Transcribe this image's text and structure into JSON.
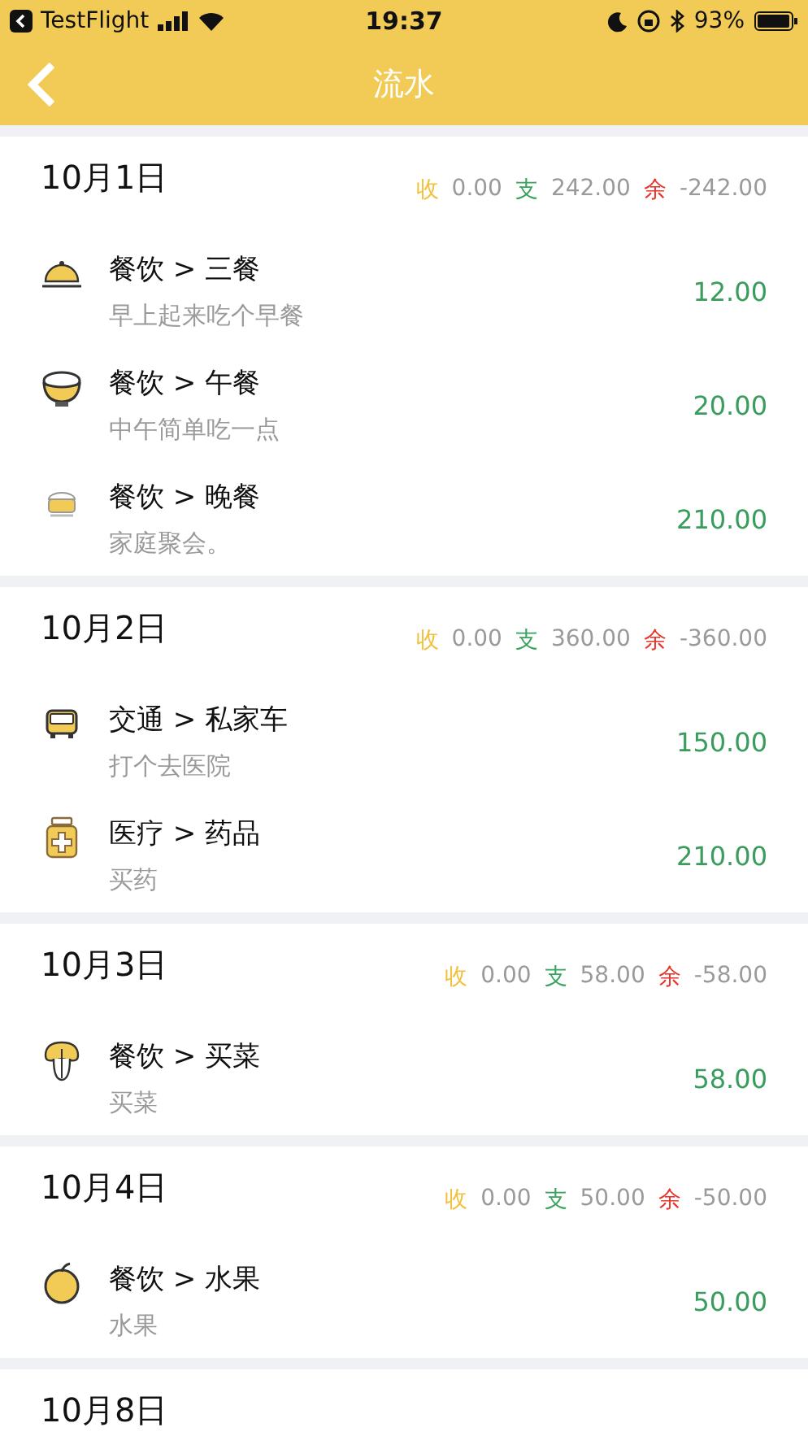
{
  "status_bar": {
    "back_app": "TestFlight",
    "time": "19:37",
    "battery": "93%"
  },
  "nav": {
    "title": "流水"
  },
  "days": [
    {
      "date": "10月1日",
      "stats": [
        {
          "kind": "income",
          "label": "收",
          "value": "0.00"
        },
        {
          "kind": "expense",
          "label": "支",
          "value": "242.00"
        },
        {
          "kind": "balance",
          "label": "余",
          "value": "-242.00"
        }
      ],
      "entries": [
        {
          "kind": "cloche",
          "title": "餐饮 > 三餐",
          "note": "早上起来吃个早餐",
          "amount": "12.00"
        },
        {
          "kind": "bowl",
          "title": "餐饮 > 午餐",
          "note": "中午简单吃一点",
          "amount": "20.00"
        },
        {
          "kind": "pot",
          "title": "餐饮 > 晚餐",
          "note": "家庭聚会。",
          "amount": "210.00"
        }
      ]
    },
    {
      "date": "10月2日",
      "stats": [
        {
          "kind": "income",
          "label": "收",
          "value": "0.00"
        },
        {
          "kind": "expense",
          "label": "支",
          "value": "360.00"
        },
        {
          "kind": "balance",
          "label": "余",
          "value": "-360.00"
        }
      ],
      "entries": [
        {
          "kind": "car",
          "title": "交通 > 私家车",
          "note": "打个去医院",
          "amount": "150.00"
        },
        {
          "kind": "medicine",
          "title": "医疗 > 药品",
          "note": "买药",
          "amount": "210.00"
        }
      ]
    },
    {
      "date": "10月3日",
      "stats": [
        {
          "kind": "income",
          "label": "收",
          "value": "0.00"
        },
        {
          "kind": "expense",
          "label": "支",
          "value": "58.00"
        },
        {
          "kind": "balance",
          "label": "余",
          "value": "-58.00"
        }
      ],
      "entries": [
        {
          "kind": "vegetable",
          "title": "餐饮 > 买菜",
          "note": "买菜",
          "amount": "58.00"
        }
      ]
    },
    {
      "date": "10月4日",
      "stats": [
        {
          "kind": "income",
          "label": "收",
          "value": "0.00"
        },
        {
          "kind": "expense",
          "label": "支",
          "value": "50.00"
        },
        {
          "kind": "balance",
          "label": "余",
          "value": "-50.00"
        }
      ],
      "entries": [
        {
          "kind": "apple",
          "title": "餐饮 > 水果",
          "note": "水果",
          "amount": "50.00"
        }
      ]
    },
    {
      "date": "10月8日"
    }
  ]
}
